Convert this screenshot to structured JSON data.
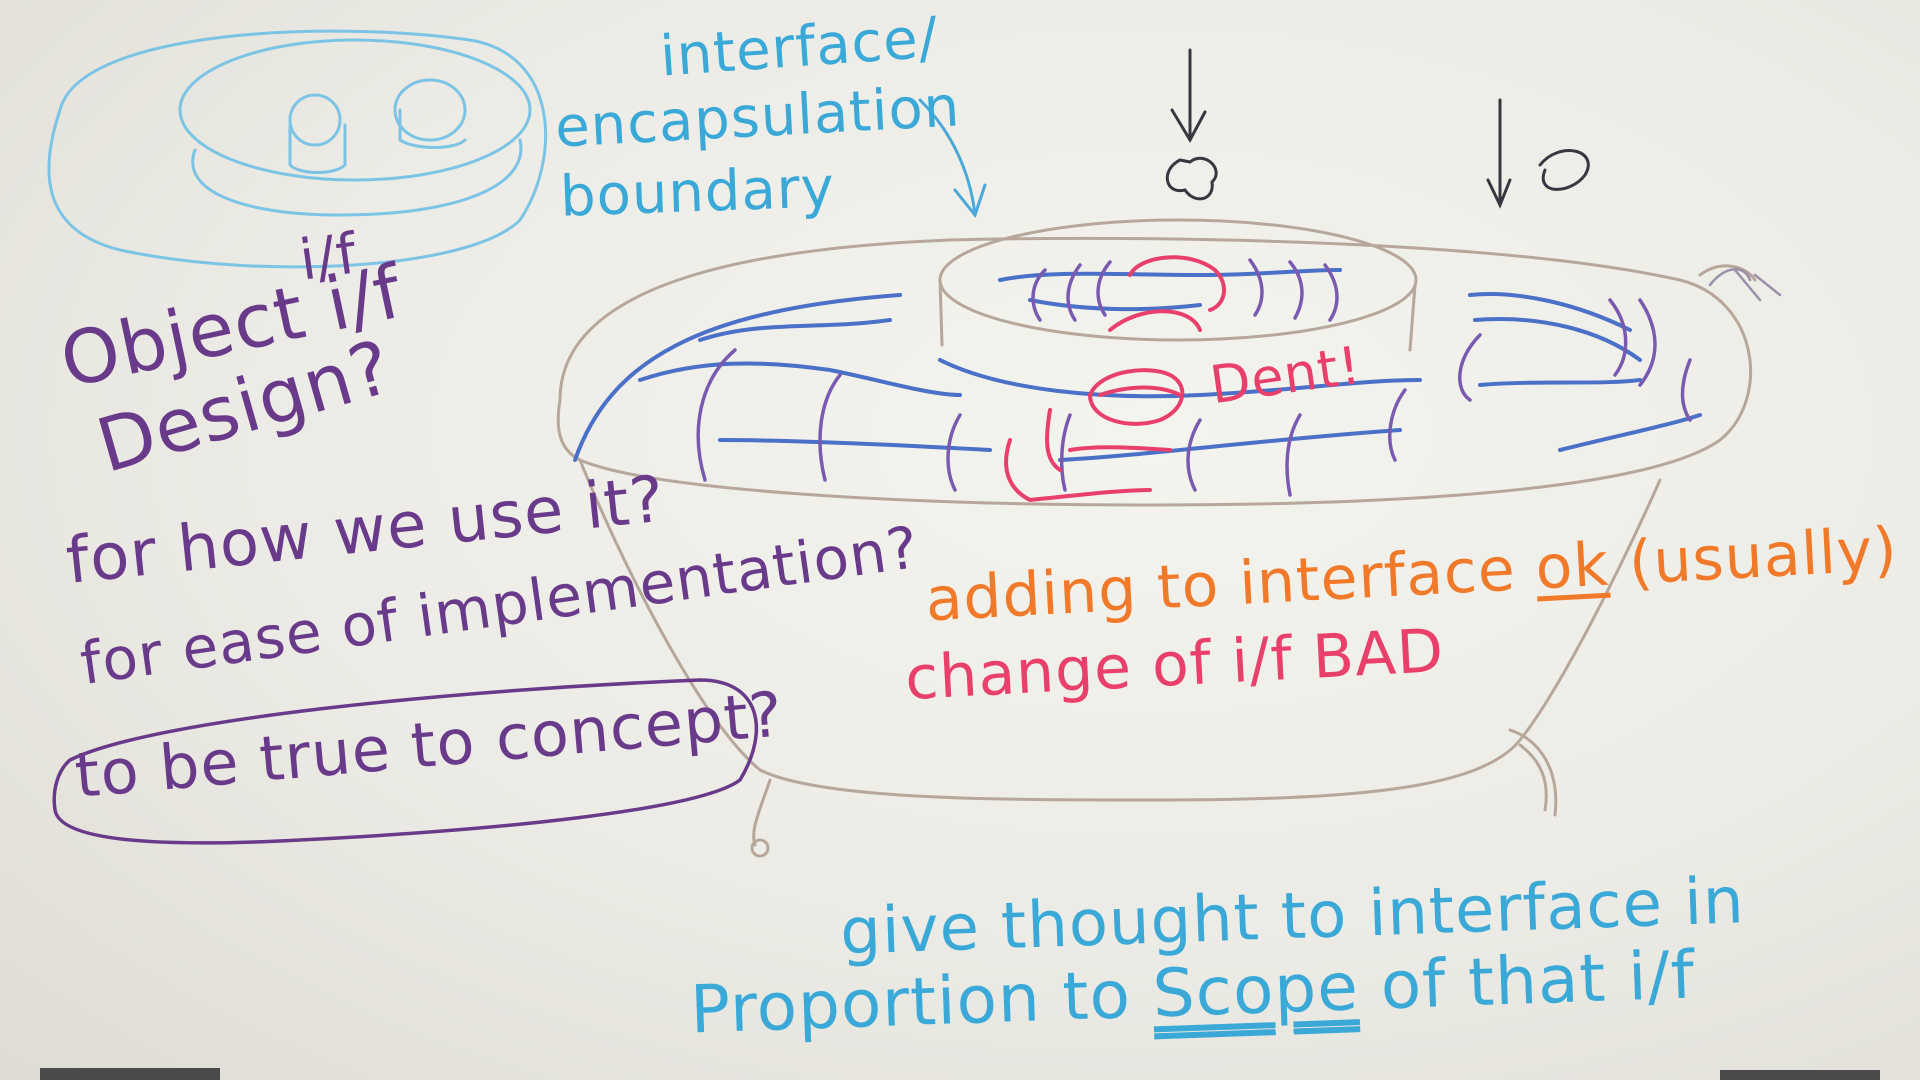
{
  "whiteboard": {
    "left_notes": {
      "line1": "Object i/f",
      "line2": "Design?",
      "line3": "for how we use it?",
      "line4": "for ease of implementation?",
      "line5": "to be true to concept?"
    },
    "top_notes": {
      "line1": "interface/",
      "line2": "encapsulation",
      "line3": "boundary"
    },
    "small_label": "i/f",
    "dent_label": "Dent!",
    "middle_notes": {
      "adding_prefix": "adding to interface ",
      "adding_ok": "ok",
      "adding_suffix": " (usually)",
      "change": "change of i/f BAD"
    },
    "bottom_notes": {
      "line1": "give thought to interface in",
      "line2_prefix": "Proportion to ",
      "line2_scope": "Scope",
      "line2_suffix": " of that i/f"
    }
  },
  "colors": {
    "purple": "#6a3a8a",
    "cyan": "#3aa9d8",
    "blue": "#4a70c8",
    "orange": "#f07a2a",
    "pink": "#e8406a",
    "tan": "#b7a79a",
    "black": "#3a3640"
  }
}
